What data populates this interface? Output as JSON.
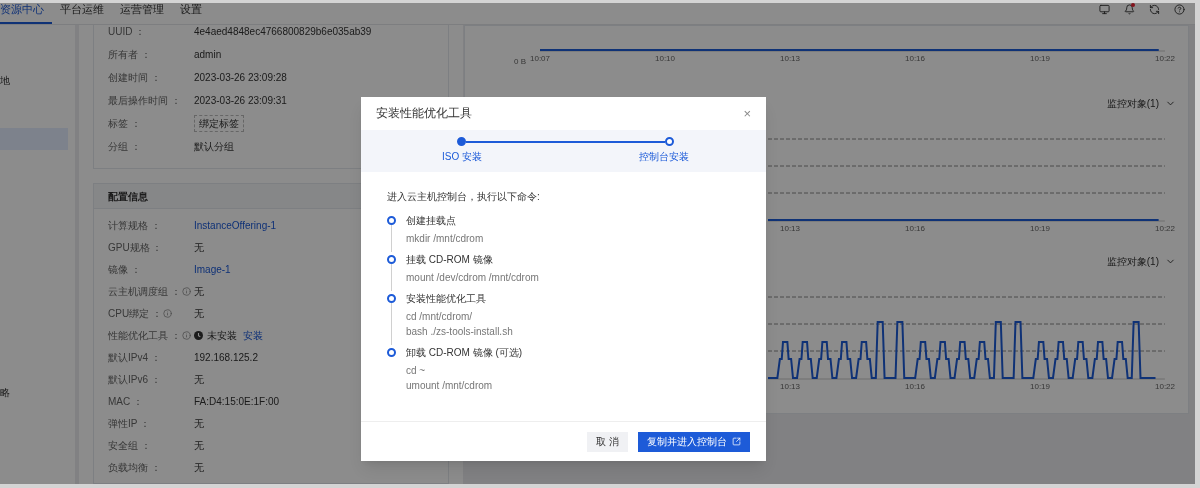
{
  "nav": {
    "tabs": [
      {
        "label": "资源中心",
        "selected": true
      },
      {
        "label": "平台运维",
        "selected": false
      },
      {
        "label": "运营管理",
        "selected": false
      },
      {
        "label": "设置",
        "selected": false
      }
    ],
    "notification_dot": true
  },
  "sidebar": {
    "items": [
      {
        "label": "地",
        "selected": false
      },
      {
        "selected": true
      },
      {
        "label": "略",
        "selected": false
      }
    ]
  },
  "basic_info": [
    {
      "label": "UUID ：",
      "value": "4e4aed4848ec4766800829b6e035ab39",
      "kind": "text"
    },
    {
      "label": "所有者 ：",
      "value": "admin",
      "kind": "text"
    },
    {
      "label": "创建时间 ：",
      "value": "2023-03-26 23:09:28",
      "kind": "text"
    },
    {
      "label": "最后操作时间 ：",
      "value": "2023-03-26 23:09:31",
      "kind": "text"
    },
    {
      "label": "标签 ：",
      "value": "绑定标签",
      "kind": "tag"
    },
    {
      "label": "分组 ：",
      "value": "默认分组",
      "kind": "text"
    }
  ],
  "config": {
    "title": "配置信息",
    "rows": [
      {
        "label": "计算规格 ：",
        "hint": false,
        "value": "InstanceOffering-1",
        "kind": "link"
      },
      {
        "label": "GPU规格 ：",
        "hint": false,
        "value": "无",
        "kind": "text"
      },
      {
        "label": "镜像 ：",
        "hint": false,
        "value": "Image-1",
        "kind": "link"
      },
      {
        "label": "云主机调度组 ：",
        "hint": true,
        "value": "无",
        "kind": "text"
      },
      {
        "label": "CPU绑定 ：",
        "hint": true,
        "value": "无",
        "kind": "text"
      },
      {
        "label": "性能优化工具 ：",
        "hint": true,
        "value": "未安装",
        "action": "安装",
        "kind": "status"
      },
      {
        "label": "默认IPv4 ：",
        "hint": false,
        "value": "192.168.125.2",
        "kind": "text"
      },
      {
        "label": "默认IPv6 ：",
        "hint": false,
        "value": "无",
        "kind": "text"
      },
      {
        "label": "MAC ：",
        "hint": false,
        "value": "FA:D4:15:0E:1F:00",
        "kind": "text"
      },
      {
        "label": "弹性IP ：",
        "hint": false,
        "value": "无",
        "kind": "text"
      },
      {
        "label": "安全组 ：",
        "hint": false,
        "value": "无",
        "kind": "text"
      },
      {
        "label": "负载均衡 ：",
        "hint": false,
        "value": "无",
        "kind": "text"
      }
    ]
  },
  "charts": [
    {
      "kind": "flat",
      "y_label": "0 B",
      "ticks": [
        "10:07",
        "10:10",
        "10:13",
        "10:16",
        "10:19",
        "10:22"
      ]
    },
    {
      "kind": "flat",
      "monitor": "监控对象(1)",
      "ticks": [
        "10:13",
        "10:16",
        "10:19",
        "10:22"
      ]
    },
    {
      "kind": "pulse",
      "monitor": "监控对象(1)",
      "ticks": [
        "10:13",
        "10:16",
        "10:19",
        "10:22"
      ]
    }
  ],
  "modal": {
    "title": "安装性能优化工具",
    "close": "×",
    "steps": [
      {
        "label": "ISO 安装",
        "done": true
      },
      {
        "label": "控制台安装",
        "done": false
      }
    ],
    "intro": "进入云主机控制台，执行以下命令:",
    "items": [
      {
        "title": "创建挂载点",
        "commands": [
          "mkdir /mnt/cdrom"
        ]
      },
      {
        "title": "挂载 CD-ROM 镜像",
        "commands": [
          "mount /dev/cdrom /mnt/cdrom"
        ]
      },
      {
        "title": "安装性能优化工具",
        "commands": [
          "cd /mnt/cdrom/",
          "bash ./zs-tools-install.sh"
        ]
      },
      {
        "title": "卸载 CD-ROM 镜像 (可选)",
        "commands": [
          "cd ~",
          "umount /mnt/cdrom"
        ]
      }
    ],
    "buttons": [
      {
        "label": "取 消",
        "kind": "secondary"
      },
      {
        "label": "复制并进入控制台",
        "kind": "primary",
        "external": true
      }
    ]
  }
}
